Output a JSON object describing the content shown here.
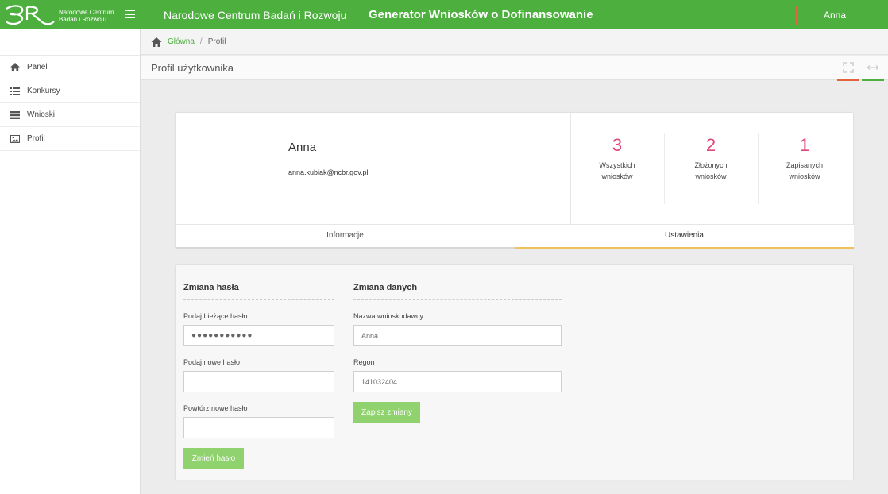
{
  "header": {
    "logo_line1": "Narodowe Centrum",
    "logo_line2": "Badań i Rozwoju",
    "org_title": "Narodowe Centrum Badań i Rozwoju",
    "app_title": "Generator Wniosków o Dofinansowanie",
    "user_name": "Anna"
  },
  "sidebar": {
    "items": [
      {
        "label": "Panel",
        "icon": "home-icon"
      },
      {
        "label": "Konkursy",
        "icon": "list-icon"
      },
      {
        "label": "Wnioski",
        "icon": "stack-icon"
      },
      {
        "label": "Profil",
        "icon": "image-icon"
      }
    ]
  },
  "breadcrumb": {
    "home": "Główna",
    "separator": "/",
    "current": "Profil"
  },
  "page": {
    "title": "Profil użytkownika"
  },
  "profile": {
    "name": "Anna",
    "email": "anna.kubiak@ncbr.gov.pl",
    "stats": [
      {
        "value": "3",
        "label_line1": "Wszystkich",
        "label_line2": "wniosków"
      },
      {
        "value": "2",
        "label_line1": "Złożonych",
        "label_line2": "wniosków"
      },
      {
        "value": "1",
        "label_line1": "Zapisanych",
        "label_line2": "wniosków"
      }
    ],
    "tabs": [
      {
        "label": "Informacje"
      },
      {
        "label": "Ustawienia",
        "active": true
      }
    ]
  },
  "password_form": {
    "title": "Zmiana hasła",
    "current_label": "Podaj bieżące hasło",
    "current_value": "●●●●●●●●●●●",
    "new_label": "Podaj nowe hasło",
    "new_value": "",
    "repeat_label": "Powtórz nowe hasło",
    "repeat_value": "",
    "submit_label": "Zmień hasło"
  },
  "data_form": {
    "title": "Zmiana danych",
    "applicant_label": "Nazwa wnioskodawcy",
    "applicant_value": "Anna",
    "regon_label": "Regon",
    "regon_value": "141032404",
    "submit_label": "Zapisz zmiany"
  },
  "colors": {
    "brand_green": "#4caf3e",
    "stat_pink": "#e0457b",
    "button_green": "#8fd26e",
    "tab_active_underline": "#f0c05a",
    "accent_red": "#e0653a"
  }
}
